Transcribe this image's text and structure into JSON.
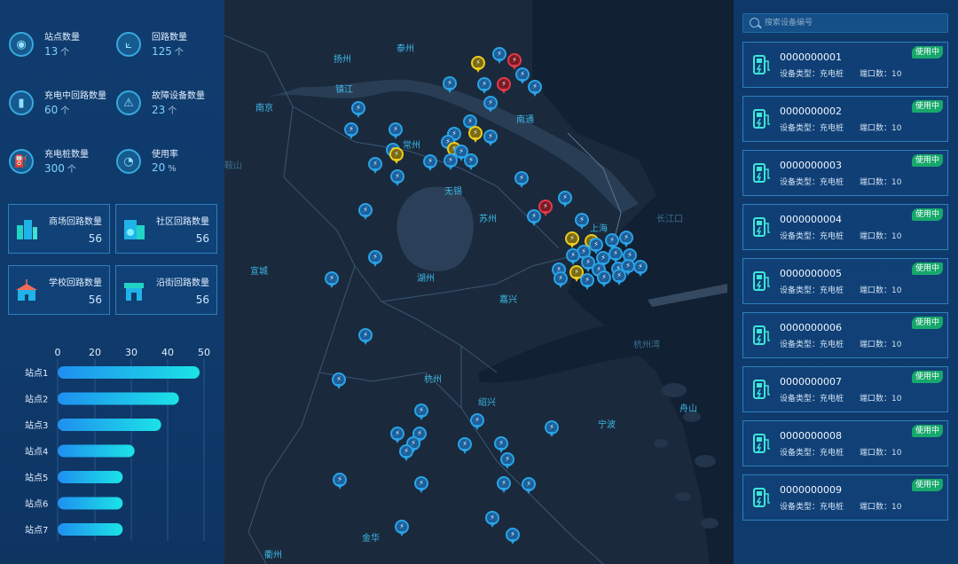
{
  "stats": [
    {
      "label": "站点数量",
      "value": "13",
      "unit": "个",
      "icon": "location-icon"
    },
    {
      "label": "回路数量",
      "value": "125",
      "unit": "个",
      "icon": "circuit-icon"
    },
    {
      "label": "充电中回路数量",
      "value": "60",
      "unit": "个",
      "icon": "battery-icon"
    },
    {
      "label": "故障设备数量",
      "value": "23",
      "unit": "个",
      "icon": "warning-icon"
    },
    {
      "label": "充电桩数量",
      "value": "300",
      "unit": "个",
      "icon": "charger-icon"
    },
    {
      "label": "使用率",
      "value": "20",
      "unit": "%",
      "icon": "gauge-icon"
    }
  ],
  "circuit_cards": [
    {
      "label": "商场回路数量",
      "value": "56",
      "icon": "mall-icon"
    },
    {
      "label": "社区回路数量",
      "value": "56",
      "icon": "community-icon"
    },
    {
      "label": "学校回路数量",
      "value": "56",
      "icon": "school-icon"
    },
    {
      "label": "沿街回路数量",
      "value": "56",
      "icon": "shop-icon"
    }
  ],
  "chart_data": {
    "type": "bar",
    "orientation": "horizontal",
    "categories": [
      "站点1",
      "站点2",
      "站点3",
      "站点4",
      "站点5",
      "站点6",
      "站点7"
    ],
    "values": [
      48,
      41,
      35,
      26,
      22,
      22,
      22
    ],
    "xlim": [
      0,
      50
    ],
    "xticks": [
      "0",
      "20",
      "30",
      "40",
      "50"
    ],
    "tick_values": [
      0,
      20,
      30,
      40,
      50
    ],
    "grid": true,
    "colors": {
      "start": "#1f8ff0",
      "end": "#1ce3e6"
    }
  },
  "map": {
    "cities": [
      "扬州",
      "泰州",
      "镇江",
      "南京",
      "南通",
      "常州",
      "无锡",
      "苏州",
      "上海",
      "宣城",
      "湖州",
      "嘉兴",
      "杭州",
      "绍兴",
      "宁波",
      "舟山",
      "金华",
      "衢州",
      "鞍山",
      "长江口",
      "杭州湾"
    ],
    "pin_glyph": "⚡"
  },
  "search": {
    "placeholder": "搜索设备编号"
  },
  "devices": [
    {
      "id": "0000000001",
      "type": "设备类型：充电桩",
      "ports": "端口数：10",
      "status": "使用中"
    },
    {
      "id": "0000000002",
      "type": "设备类型：充电桩",
      "ports": "端口数：10",
      "status": "使用中"
    },
    {
      "id": "0000000003",
      "type": "设备类型：充电桩",
      "ports": "端口数：10",
      "status": "使用中"
    },
    {
      "id": "0000000004",
      "type": "设备类型：充电桩",
      "ports": "端口数：10",
      "status": "使用中"
    },
    {
      "id": "0000000005",
      "type": "设备类型：充电桩",
      "ports": "端口数：10",
      "status": "使用中"
    },
    {
      "id": "0000000006",
      "type": "设备类型：充电桩",
      "ports": "端口数：10",
      "status": "使用中"
    },
    {
      "id": "0000000007",
      "type": "设备类型：充电桩",
      "ports": "端口数：10",
      "status": "使用中"
    },
    {
      "id": "0000000008",
      "type": "设备类型：充电桩",
      "ports": "端口数：10",
      "status": "使用中"
    },
    {
      "id": "0000000009",
      "type": "设备类型：充电桩",
      "ports": "端口数：10",
      "status": "使用中"
    }
  ]
}
